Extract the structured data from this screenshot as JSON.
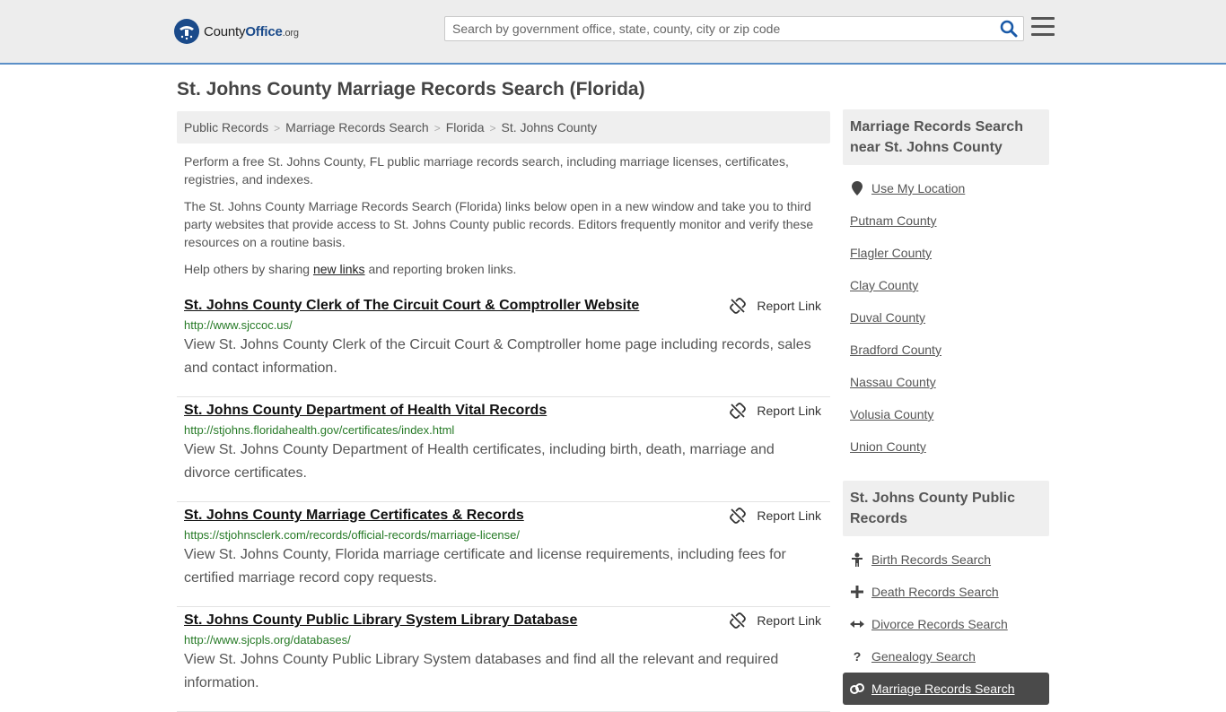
{
  "header": {
    "logo_name": "County",
    "logo_brand": "Office",
    "logo_tld": ".org",
    "search_placeholder": "Search by government office, state, county, city or zip code"
  },
  "page": {
    "title": "St. Johns County Marriage Records Search (Florida)"
  },
  "breadcrumb": [
    "Public Records",
    "Marriage Records Search",
    "Florida",
    "St. Johns County"
  ],
  "intro": {
    "p1": "Perform a free St. Johns County, FL public marriage records search, including marriage licenses, certificates, registries, and indexes.",
    "p2": "The St. Johns County Marriage Records Search (Florida) links below open in a new window and take you to third party websites that provide access to St. Johns County public records. Editors frequently monitor and verify these resources on a routine basis.",
    "p3_before": "Help others by sharing ",
    "p3_link": "new links",
    "p3_after": " and reporting broken links."
  },
  "report_label": "Report Link",
  "results": [
    {
      "title": "St. Johns County Clerk of The Circuit Court & Comptroller Website",
      "url": "http://www.sjccoc.us/",
      "desc": "View St. Johns County Clerk of the Circuit Court & Comptroller home page including records, sales and contact information."
    },
    {
      "title": "St. Johns County Department of Health Vital Records",
      "url": "http://stjohns.floridahealth.gov/certificates/index.html",
      "desc": "View St. Johns County Department of Health certificates, including birth, death, marriage and divorce certificates."
    },
    {
      "title": "St. Johns County Marriage Certificates & Records",
      "url": "https://stjohnsclerk.com/records/official-records/marriage-license/",
      "desc": "View St. Johns County, Florida marriage certificate and license requirements, including fees for certified marriage record copy requests."
    },
    {
      "title": "St. Johns County Public Library System Library Database",
      "url": "http://www.sjcpls.org/databases/",
      "desc": "View St. Johns County Public Library System databases and find all the relevant and required information."
    }
  ],
  "sidebar": {
    "near_title": "Marriage Records Search near St. Johns County",
    "use_location": "Use My Location",
    "counties": [
      "Putnam County",
      "Flagler County",
      "Clay County",
      "Duval County",
      "Bradford County",
      "Nassau County",
      "Volusia County",
      "Union County"
    ],
    "public_title": "St. Johns County Public Records",
    "public_links": [
      {
        "label": "Birth Records Search",
        "icon": "baby-icon"
      },
      {
        "label": "Death Records Search",
        "icon": "cross-icon"
      },
      {
        "label": "Divorce Records Search",
        "icon": "arrows-icon"
      },
      {
        "label": "Genealogy Search",
        "icon": "question-icon"
      },
      {
        "label": "Marriage Records Search",
        "icon": "rings-icon"
      }
    ]
  },
  "colors": {
    "header_bg": "#ededed",
    "header_border": "#5b8fc7",
    "logo_blue": "#1a4a8a",
    "search_icon": "#1a5aa8",
    "url_green": "#267a26",
    "active_item_bg": "#4a4a4a"
  }
}
